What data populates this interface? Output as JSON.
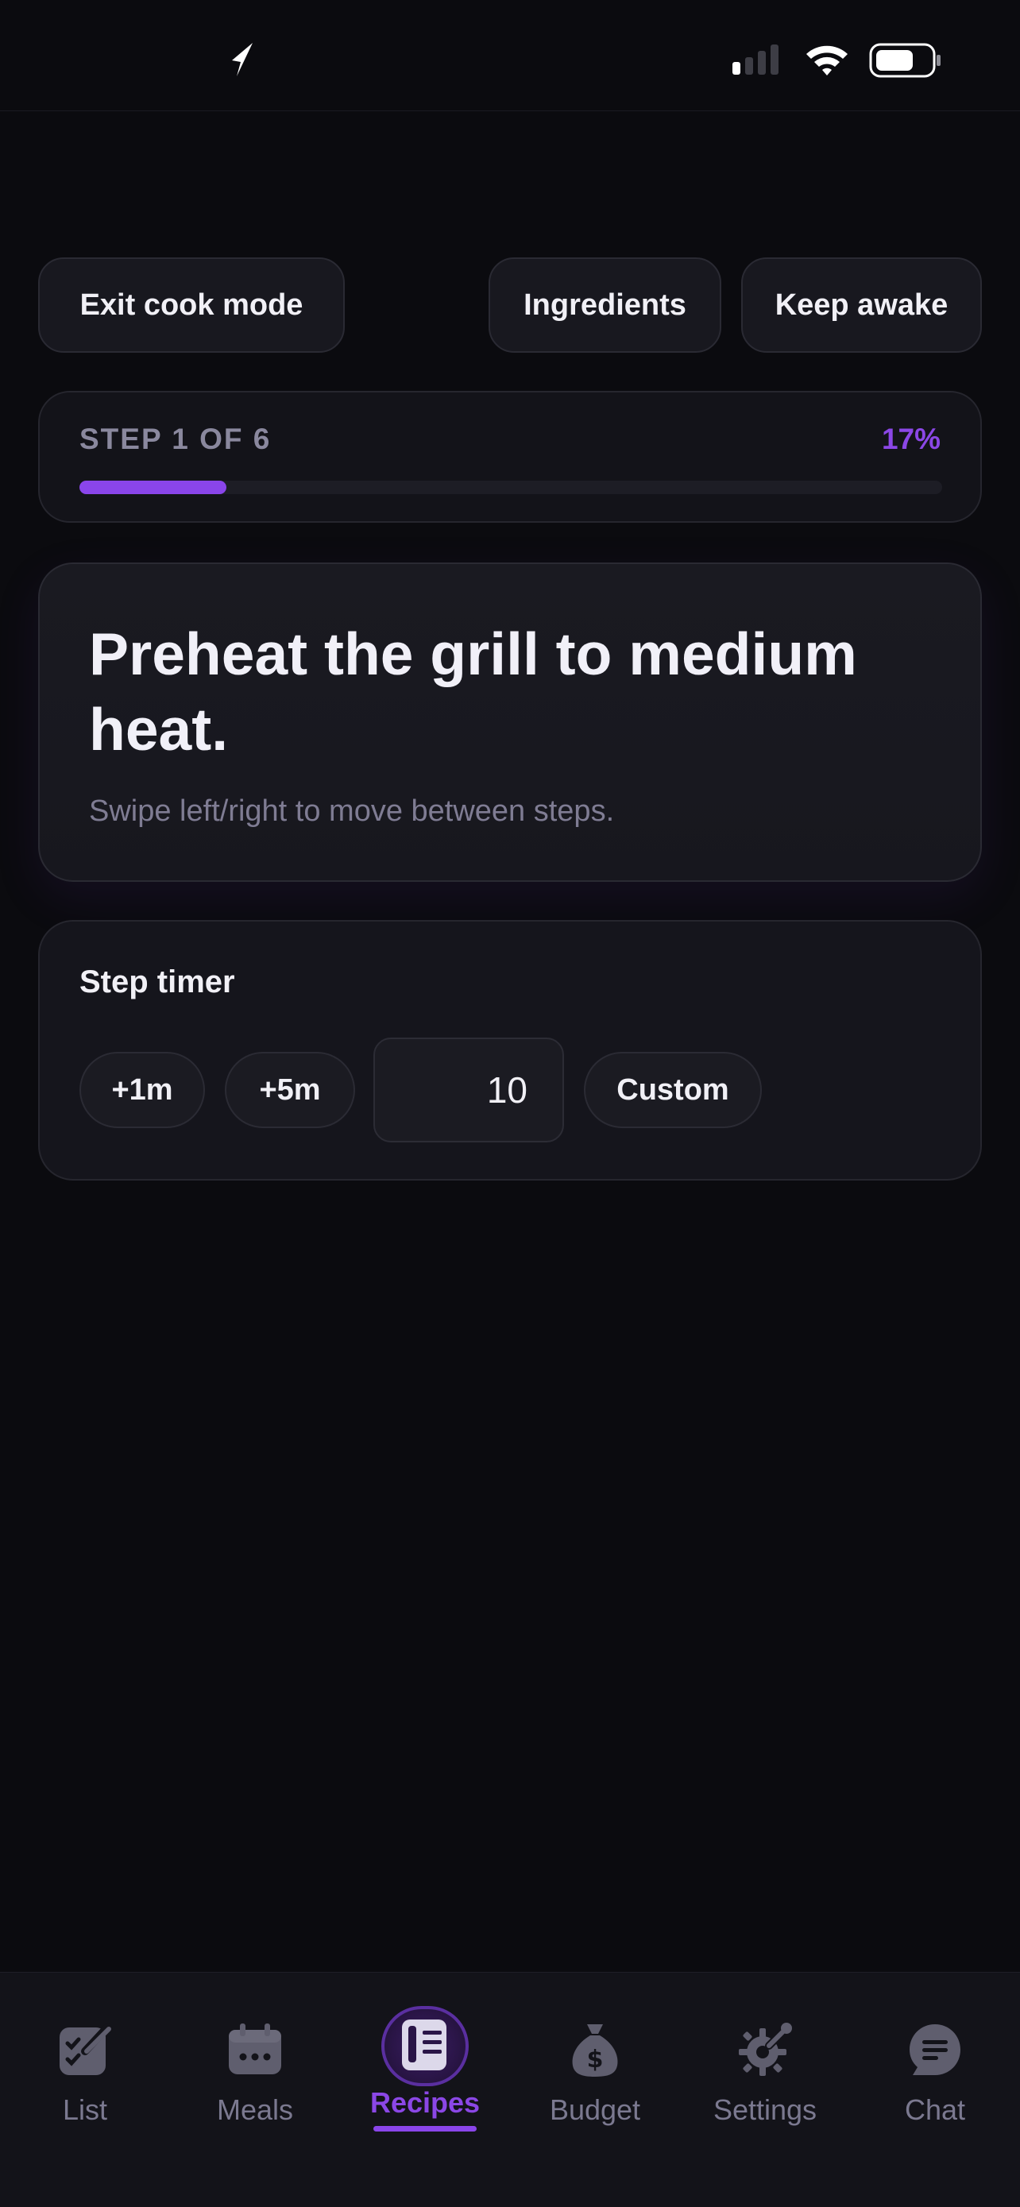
{
  "status_bar": {
    "location_icon": "location-arrow-icon",
    "signal_icon": "cellular-signal-icon",
    "wifi_icon": "wifi-icon",
    "battery_icon": "battery-icon"
  },
  "toolbar": {
    "exit_label": "Exit cook mode",
    "ingredients_label": "Ingredients",
    "keep_awake_label": "Keep awake"
  },
  "progress": {
    "step_label": "STEP 1 OF 6",
    "percent_label": "17%",
    "fraction": 0.17,
    "current_step": 1,
    "total_steps": 6
  },
  "step": {
    "instruction": "Preheat the grill to medium heat.",
    "hint": "Swipe left/right to move between steps."
  },
  "timer": {
    "title": "Step timer",
    "add_1m_label": "+1m",
    "add_5m_label": "+5m",
    "minutes_value": "10",
    "custom_label": "Custom"
  },
  "tabs": [
    {
      "label": "List",
      "icon": "checklist-icon",
      "active": false
    },
    {
      "label": "Meals",
      "icon": "calendar-icon",
      "active": false
    },
    {
      "label": "Recipes",
      "icon": "recipe-book-icon",
      "active": true
    },
    {
      "label": "Budget",
      "icon": "money-bag-icon",
      "active": false
    },
    {
      "label": "Settings",
      "icon": "gear-wrench-icon",
      "active": false
    },
    {
      "label": "Chat",
      "icon": "chat-bubble-icon",
      "active": false
    }
  ],
  "colors": {
    "accent": "#8a45ea",
    "background": "#0b0b0f",
    "card": "#15151c",
    "muted_text": "#7f7c93"
  }
}
